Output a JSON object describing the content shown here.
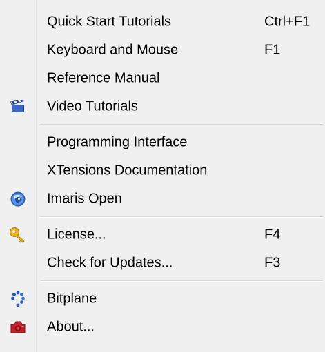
{
  "menu": {
    "groups": [
      {
        "items": [
          {
            "label": "Quick Start Tutorials",
            "shortcut": "Ctrl+F1",
            "icon": null
          },
          {
            "label": "Keyboard and Mouse",
            "shortcut": "F1",
            "icon": null
          },
          {
            "label": "Reference Manual",
            "shortcut": "",
            "icon": null
          },
          {
            "label": "Video Tutorials",
            "shortcut": "",
            "icon": "clapperboard-icon"
          }
        ]
      },
      {
        "items": [
          {
            "label": "Programming Interface",
            "shortcut": "",
            "icon": null
          },
          {
            "label": "XTensions Documentation",
            "shortcut": "",
            "icon": null
          },
          {
            "label": "Imaris Open",
            "shortcut": "",
            "icon": "imaris-open-icon"
          }
        ]
      },
      {
        "items": [
          {
            "label": "License...",
            "shortcut": "F4",
            "icon": "key-icon"
          },
          {
            "label": "Check for Updates...",
            "shortcut": "F3",
            "icon": ""
          }
        ]
      },
      {
        "items": [
          {
            "label": "Bitplane",
            "shortcut": "",
            "icon": "bitplane-dots-icon"
          },
          {
            "label": "About...",
            "shortcut": "",
            "icon": "camera-icon"
          }
        ]
      }
    ]
  },
  "colors": {
    "background": "#f0f0f0",
    "text": "#000000",
    "separator": "#d7d7d7"
  }
}
